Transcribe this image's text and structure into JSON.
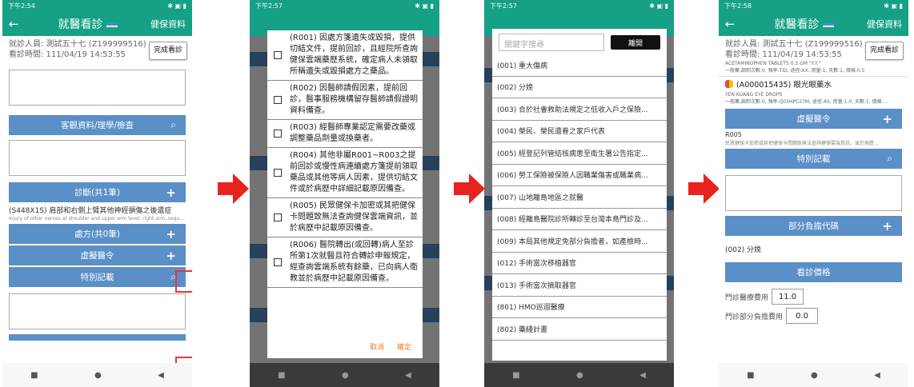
{
  "status": {
    "p1_time": "下午2:54",
    "p2_time": "下午2:57",
    "p3_time": "下午2:57",
    "p4_time": "下午2:58"
  },
  "appbar": {
    "back": "←",
    "title": "就醫看診",
    "health_data": "健保資料"
  },
  "info": {
    "patient": "就診人員: 測試五十七 (Z199999516)",
    "visit_time": "看診時間: 111/04/19 14:53:55",
    "done_button": "完成看診"
  },
  "sections": {
    "objective": "客觀資料/理學/檢查",
    "diagnosis": "診斷(共1筆)",
    "prescription": "處方(共0筆)",
    "virtual_order": "虛擬醫令",
    "special": "特別記載",
    "copay_code": "部分負擔代碼",
    "view_price": "看診價格"
  },
  "diagnosis": {
    "code_name": "(S448X1S) 肩部和右側上臂其他神經損傷之後遺症",
    "english": "Injury of other nerves at shoulder and upper arm level, right arm, sequ..."
  },
  "dialog": {
    "options": [
      "(R001) 因處方箋遺失或毀損，提供切結文件，提前回診，且經院所查詢健保雲端藥歷系統，確定病人未領取所稱遺失或毀損處方之藥品。",
      "(R002) 因醫師請假因素，提前回診，醫事服務機構留存醫師請假證明資料備查。",
      "(R003) 經醫師專業認定需要改藥或調整藥品劑量或換藥者。",
      "(R004) 其他非屬R001~R003之提前回診或慢性病連續處方箋提前領取藥品或其他等病人因素，提供切結文件或於病歷中詳細記載原因備查。",
      "(R005) 民眾健保卡加密或其把健保卡問題致無法查詢健保雲端資訊，並於病歷中記載原因備查。",
      "(R006) 醫院轉出(或回轉)病人至診所第1次就醫且符合轉診申報規定，經查詢雲端系統有餘藥，已向病人衛教並於病歷中記載原因備查。"
    ],
    "cancel": "取消",
    "confirm": "確定"
  },
  "copay_sheet": {
    "search_placeholder": "關鍵字搜尋",
    "close": "離開",
    "items": [
      "(001) 重大傷病",
      "(002) 分娩",
      "(003) 合於社會救助法規定之低收入戶之保險...",
      "(004) 榮民、榮民遺眷之家戶代表",
      "(005) 經登記列管結核病患至衛生署公告指定...",
      "(006) 勞工保險被保險人因職業傷害或職業病...",
      "(007) 山地離島地區之就醫",
      "(008) 經離島醫院診所轉診至台灣本島門診及...",
      "(009) 本局其他規定免部分負擔者，如產檢時...",
      "(012) 手術當次移植器官",
      "(013) 手術當次摘取器官",
      "(801) HMO巡迴醫療",
      "(802) 藥綫計畫"
    ]
  },
  "p4": {
    "drug1": "ACETAMINOPHEN TABLETS 0.3 GM \"Y.Y.\"",
    "drug1_sub": "一般藥,調劑次數:0, 頻率:TID, 途徑:XX, 用量:1, 天數:1, 價格:0.5",
    "drug2": "(A000015435) 眼光眼藥水",
    "drug2_en": "YEN KUANG EYE DROPS",
    "drug2_sub": "一般藥,調劑次數:0, 頻率:Q03HPC27M, 途徑:AS, 用量:1.0, 天數:1, 價格:...",
    "r_code": "R005",
    "r_desc": "民眾健保卡加密或其把健保卡問題致無法查詢健保雲端資訊，並於病歷...",
    "copay_value": "(002) 分娩",
    "outpatient_fee_label": "門診醫療費用",
    "outpatient_fee": "11.0",
    "copay_fee_label": "門診部分負擔費用",
    "copay_fee": "0.0"
  },
  "nav": {
    "recent": "■",
    "home": "●",
    "back": "◀"
  },
  "colors": {
    "appbar": "#16a085",
    "section": "#5a8fc8",
    "highlight": "#e53935",
    "arrow": "#e8221d"
  }
}
